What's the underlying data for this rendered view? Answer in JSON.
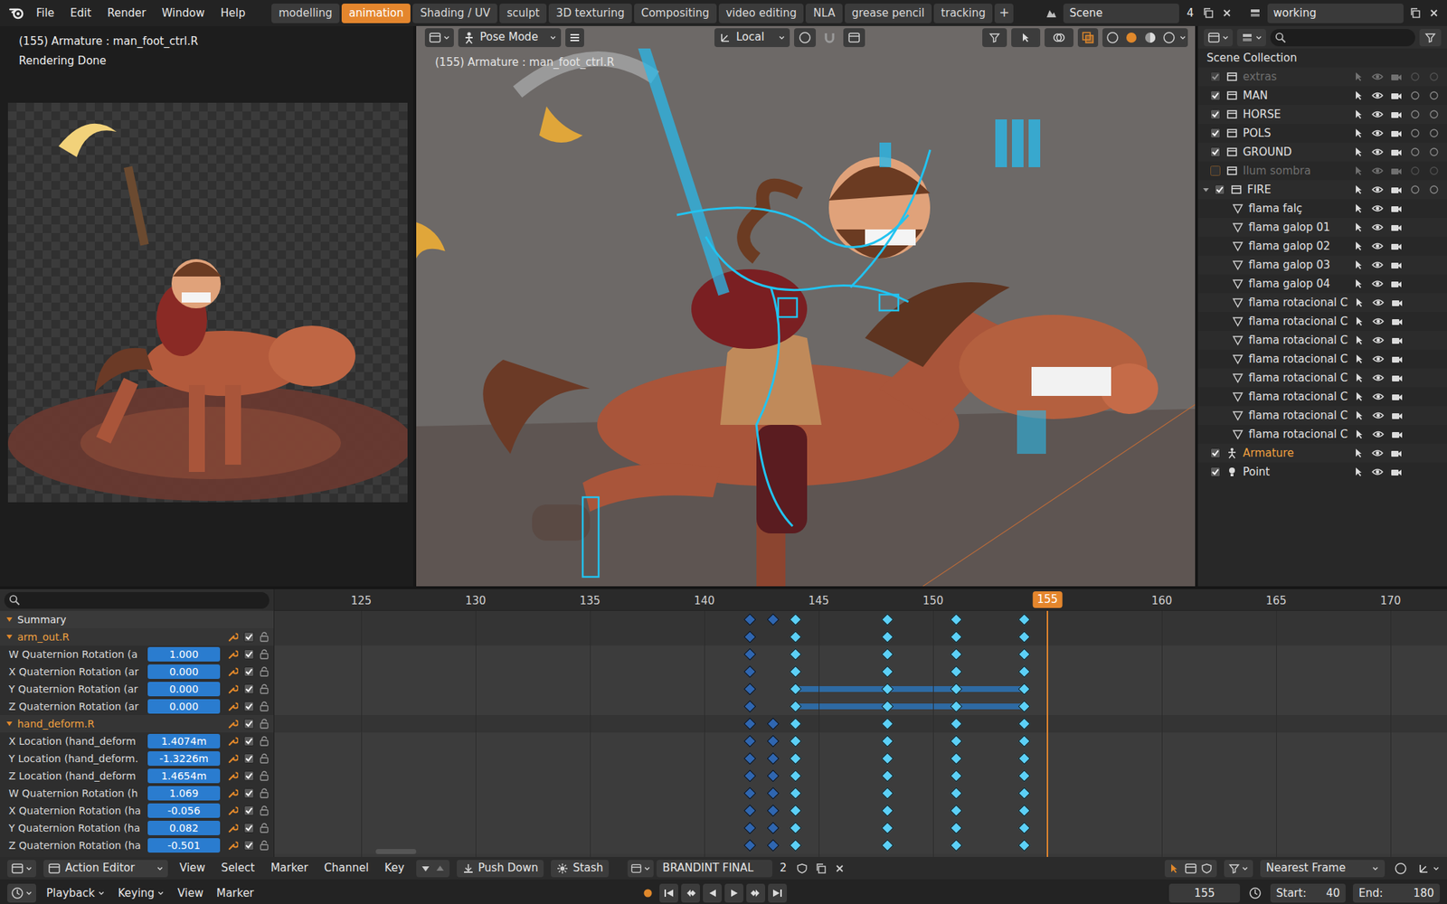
{
  "top_bar": {
    "menus": [
      "File",
      "Edit",
      "Render",
      "Window",
      "Help"
    ],
    "workspaces": [
      {
        "label": "modelling",
        "selected": false
      },
      {
        "label": "animation",
        "selected": true
      },
      {
        "label": "Shading / UV",
        "selected": false
      },
      {
        "label": "sculpt",
        "selected": false
      },
      {
        "label": "3D texturing",
        "selected": false
      },
      {
        "label": "Compositing",
        "selected": false
      },
      {
        "label": "video editing",
        "selected": false
      },
      {
        "label": "NLA",
        "selected": false
      },
      {
        "label": "grease pencil",
        "selected": false
      },
      {
        "label": "tracking",
        "selected": false
      }
    ],
    "add_workspace": "+",
    "scene": {
      "name": "Scene",
      "users": "4"
    },
    "view_layer": "working"
  },
  "render_panel": {
    "lines": [
      "(155) Armature : man_foot_ctrl.R",
      "Rendering Done"
    ]
  },
  "viewport": {
    "mode": "Pose Mode",
    "orientation": "Local",
    "overlay_text": "(155) Armature : man_foot_ctrl.R"
  },
  "outliner": {
    "root": "Scene Collection",
    "items": [
      {
        "label": "extras",
        "kind": "collection",
        "checked": true,
        "disabled": true,
        "selected": false
      },
      {
        "label": "MAN",
        "kind": "collection",
        "checked": true,
        "disabled": false,
        "selected": false
      },
      {
        "label": "HORSE",
        "kind": "collection",
        "checked": true,
        "disabled": false,
        "selected": false
      },
      {
        "label": "POLS",
        "kind": "collection",
        "checked": true,
        "disabled": false,
        "selected": false
      },
      {
        "label": "GROUND",
        "kind": "collection",
        "checked": true,
        "disabled": false,
        "selected": false
      },
      {
        "label": "Ilum sombra",
        "kind": "collection",
        "checked": false,
        "disabled": true,
        "selected": false
      },
      {
        "label": "FIRE",
        "kind": "collection",
        "checked": true,
        "disabled": false,
        "selected": false,
        "expanded": true,
        "children": [
          {
            "label": "flama falç",
            "kind": "object",
            "disabled": false,
            "selected": false
          },
          {
            "label": "flama galop 01",
            "kind": "object",
            "disabled": false,
            "selected": false
          },
          {
            "label": "flama galop 02",
            "kind": "object",
            "disabled": false,
            "selected": false
          },
          {
            "label": "flama galop 03",
            "kind": "object",
            "disabled": false,
            "selected": false
          },
          {
            "label": "flama galop 04",
            "kind": "object",
            "disabled": false,
            "selected": false
          },
          {
            "label": "flama rotacional C",
            "kind": "object",
            "disabled": false,
            "selected": false
          },
          {
            "label": "flama rotacional C",
            "kind": "object",
            "disabled": false,
            "selected": false
          },
          {
            "label": "flama rotacional C",
            "kind": "object",
            "disabled": false,
            "selected": false
          },
          {
            "label": "flama rotacional C",
            "kind": "object",
            "disabled": false,
            "selected": false
          },
          {
            "label": "flama rotacional C",
            "kind": "object",
            "disabled": false,
            "selected": false
          },
          {
            "label": "flama rotacional C",
            "kind": "object",
            "disabled": false,
            "selected": false
          },
          {
            "label": "flama rotacional C",
            "kind": "object",
            "disabled": false,
            "selected": false
          },
          {
            "label": "flama rotacional C",
            "kind": "object",
            "disabled": false,
            "selected": false
          }
        ]
      },
      {
        "label": "Armature",
        "kind": "armature",
        "checked": true,
        "disabled": false,
        "selected": true
      },
      {
        "label": "Point",
        "kind": "light",
        "checked": true,
        "disabled": false,
        "selected": false
      }
    ]
  },
  "dopesheet": {
    "ticks": [
      "125",
      "130",
      "135",
      "140",
      "145",
      "150",
      "155",
      "160",
      "165",
      "170"
    ],
    "current_frame": "155",
    "channels": [
      {
        "kind": "summary",
        "label": "Summary",
        "expanded": true,
        "keys": [
          {
            "frame": 142,
            "selected": false
          },
          {
            "frame": 143,
            "selected": false
          },
          {
            "frame": 144,
            "selected": true
          },
          {
            "frame": 148,
            "selected": true
          },
          {
            "frame": 151,
            "selected": true
          },
          {
            "frame": 154,
            "selected": true
          }
        ]
      },
      {
        "kind": "group",
        "label": "arm_out.R",
        "expanded": true,
        "checked": true,
        "keys": [
          {
            "frame": 142,
            "selected": false
          },
          {
            "frame": 144,
            "selected": true
          },
          {
            "frame": 148,
            "selected": true
          },
          {
            "frame": 151,
            "selected": true
          },
          {
            "frame": 154,
            "selected": true
          }
        ]
      },
      {
        "kind": "channel",
        "label": "W Quaternion Rotation (a",
        "value": "1.000",
        "checked": true,
        "holds": [],
        "keys": [
          {
            "frame": 142,
            "selected": false
          },
          {
            "frame": 144,
            "selected": true
          },
          {
            "frame": 148,
            "selected": true
          },
          {
            "frame": 151,
            "selected": true
          },
          {
            "frame": 154,
            "selected": true
          }
        ]
      },
      {
        "kind": "channel",
        "label": "X Quaternion Rotation (ar",
        "value": "0.000",
        "checked": true,
        "holds": [],
        "keys": [
          {
            "frame": 142,
            "selected": false
          },
          {
            "frame": 144,
            "selected": true
          },
          {
            "frame": 148,
            "selected": true
          },
          {
            "frame": 151,
            "selected": true
          },
          {
            "frame": 154,
            "selected": true
          }
        ]
      },
      {
        "kind": "channel",
        "label": "Y Quaternion Rotation (ar",
        "value": "0.000",
        "checked": true,
        "holds": [
          [
            144,
            154
          ]
        ],
        "keys": [
          {
            "frame": 142,
            "selected": false
          },
          {
            "frame": 144,
            "selected": true
          },
          {
            "frame": 148,
            "selected": true
          },
          {
            "frame": 151,
            "selected": true
          },
          {
            "frame": 154,
            "selected": true
          }
        ]
      },
      {
        "kind": "channel",
        "label": "Z Quaternion Rotation (ar",
        "value": "0.000",
        "checked": true,
        "holds": [
          [
            144,
            154
          ]
        ],
        "keys": [
          {
            "frame": 142,
            "selected": false
          },
          {
            "frame": 144,
            "selected": true
          },
          {
            "frame": 148,
            "selected": true
          },
          {
            "frame": 151,
            "selected": true
          },
          {
            "frame": 154,
            "selected": true
          }
        ]
      },
      {
        "kind": "group",
        "label": "hand_deform.R",
        "expanded": true,
        "checked": true,
        "keys": [
          {
            "frame": 142,
            "selected": false
          },
          {
            "frame": 143,
            "selected": false
          },
          {
            "frame": 144,
            "selected": true
          },
          {
            "frame": 148,
            "selected": true
          },
          {
            "frame": 151,
            "selected": true
          },
          {
            "frame": 154,
            "selected": true
          }
        ]
      },
      {
        "kind": "channel",
        "label": "X Location (hand_deform",
        "value": "1.4074m",
        "checked": true,
        "holds": [],
        "keys": [
          {
            "frame": 142,
            "selected": false
          },
          {
            "frame": 143,
            "selected": false
          },
          {
            "frame": 144,
            "selected": true
          },
          {
            "frame": 148,
            "selected": true
          },
          {
            "frame": 151,
            "selected": true
          },
          {
            "frame": 154,
            "selected": true
          }
        ]
      },
      {
        "kind": "channel",
        "label": "Y Location (hand_deform.",
        "value": "-1.3226m",
        "checked": true,
        "holds": [],
        "keys": [
          {
            "frame": 142,
            "selected": false
          },
          {
            "frame": 143,
            "selected": false
          },
          {
            "frame": 144,
            "selected": true
          },
          {
            "frame": 148,
            "selected": true
          },
          {
            "frame": 151,
            "selected": true
          },
          {
            "frame": 154,
            "selected": true
          }
        ]
      },
      {
        "kind": "channel",
        "label": "Z Location (hand_deform",
        "value": "1.4654m",
        "checked": true,
        "holds": [],
        "keys": [
          {
            "frame": 142,
            "selected": false
          },
          {
            "frame": 143,
            "selected": false
          },
          {
            "frame": 144,
            "selected": true
          },
          {
            "frame": 148,
            "selected": true
          },
          {
            "frame": 151,
            "selected": true
          },
          {
            "frame": 154,
            "selected": true
          }
        ]
      },
      {
        "kind": "channel",
        "label": "W Quaternion Rotation (h",
        "value": "1.069",
        "checked": true,
        "holds": [],
        "keys": [
          {
            "frame": 142,
            "selected": false
          },
          {
            "frame": 143,
            "selected": false
          },
          {
            "frame": 144,
            "selected": true
          },
          {
            "frame": 148,
            "selected": true
          },
          {
            "frame": 151,
            "selected": true
          },
          {
            "frame": 154,
            "selected": true
          }
        ]
      },
      {
        "kind": "channel",
        "label": "X Quaternion Rotation (ha",
        "value": "-0.056",
        "checked": true,
        "holds": [],
        "keys": [
          {
            "frame": 142,
            "selected": false
          },
          {
            "frame": 143,
            "selected": false
          },
          {
            "frame": 144,
            "selected": true
          },
          {
            "frame": 148,
            "selected": true
          },
          {
            "frame": 151,
            "selected": true
          },
          {
            "frame": 154,
            "selected": true
          }
        ]
      },
      {
        "kind": "channel",
        "label": "Y Quaternion Rotation (ha",
        "value": "0.082",
        "checked": true,
        "holds": [],
        "keys": [
          {
            "frame": 142,
            "selected": false
          },
          {
            "frame": 143,
            "selected": false
          },
          {
            "frame": 144,
            "selected": true
          },
          {
            "frame": 148,
            "selected": true
          },
          {
            "frame": 151,
            "selected": true
          },
          {
            "frame": 154,
            "selected": true
          }
        ]
      },
      {
        "kind": "channel",
        "label": "Z Quaternion Rotation (ha",
        "value": "-0.501",
        "checked": true,
        "holds": [],
        "keys": [
          {
            "frame": 142,
            "selected": false
          },
          {
            "frame": 143,
            "selected": false
          },
          {
            "frame": 144,
            "selected": true
          },
          {
            "frame": 148,
            "selected": true
          },
          {
            "frame": 151,
            "selected": true
          },
          {
            "frame": 154,
            "selected": true
          }
        ]
      }
    ]
  },
  "editor_header": {
    "mode": "Action Editor",
    "menus": [
      "View",
      "Select",
      "Marker",
      "Channel",
      "Key"
    ],
    "push_down": "Push Down",
    "stash": "Stash",
    "action": "BRANDINT FINAL",
    "action_users": "2",
    "snap": "Nearest Frame"
  },
  "timeline": {
    "menus": [
      "Playback",
      "Keying",
      "View",
      "Marker"
    ],
    "frame": "155",
    "start": {
      "label": "Start:",
      "value": "40"
    },
    "end": {
      "label": "End:",
      "value": "180"
    }
  }
}
